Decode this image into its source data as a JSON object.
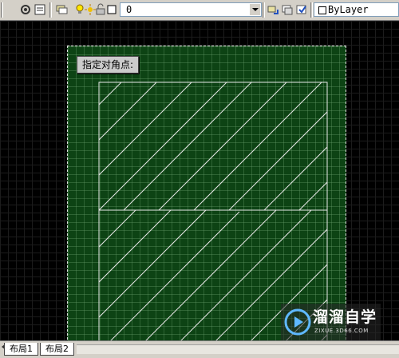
{
  "toolbar": {
    "layer_combo": {
      "value": "0"
    },
    "linetype_combo": {
      "value": "ByLayer"
    }
  },
  "drawing": {
    "prompt_tooltip": "指定对角点:",
    "paper_color": "#0d4314",
    "hatch_color": "#ffffff"
  },
  "watermark": {
    "title": "溜溜自学",
    "subtitle": "ZIXUE.3D66.COM"
  },
  "layout_tabs": [
    {
      "label": "布局1"
    },
    {
      "label": "布局2"
    }
  ],
  "icons": {
    "toolbar": [
      "gear-icon",
      "properties-icon",
      "layer-manager-icon",
      "bulb-icon",
      "sun-icon",
      "lock-icon",
      "color-box-icon",
      "dropdown-arrow-icon",
      "layer-previous-icon",
      "layer-state-icon",
      "layer-iso-icon"
    ],
    "tabs": [
      "tab-nav-prev-icon",
      "tab-nav-next-icon"
    ]
  }
}
